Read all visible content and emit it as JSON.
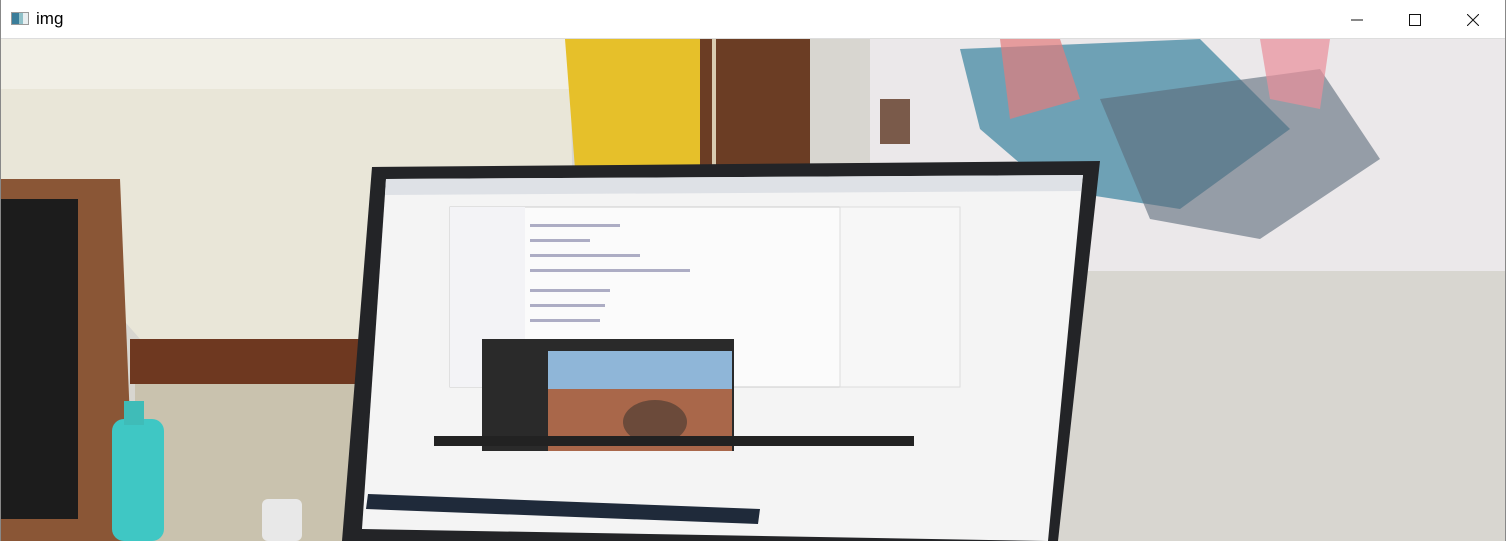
{
  "window": {
    "title": "img",
    "icon": "image-window-icon",
    "controls": {
      "minimize": "minimize-icon",
      "maximize": "maximize-icon",
      "close": "close-icon"
    }
  }
}
